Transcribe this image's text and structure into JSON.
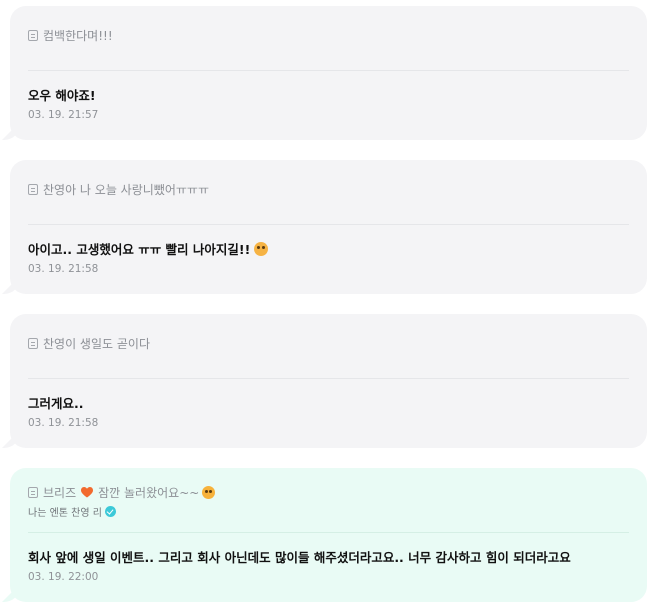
{
  "comments": [
    {
      "quote": "컴백한다며!!!",
      "reply": "오우 해야죠!",
      "time": "03. 19. 21:57"
    },
    {
      "quote": "찬영아 나 오늘 사랑니뺐어ㅠㅠㅠ",
      "reply": "아이고.. 고생했어요 ㅠㅠ 빨리 나아지길!!",
      "reply_emoji": "face-emoji",
      "time": "03. 19. 21:58"
    },
    {
      "quote": "찬영이 생일도 곧이다",
      "reply": "그러게요..",
      "time": "03. 19. 21:58"
    },
    {
      "quote_prefix": "브리즈",
      "quote_suffix": "잠깐 놀러왔어요~~",
      "quote_icons": [
        "orange-heart-icon",
        "face-emoji"
      ],
      "author": "나는 엔톤 찬영 리",
      "author_badge": "verified-icon",
      "reply": "회사 앞에 생일 이벤트.. 그리고 회사 아닌데도 많이들 해주셨더라고요.. 너무 감사하고 힘이 되더라고요",
      "time": "03. 19. 22:00"
    }
  ],
  "colors": {
    "card_bg": "#f4f4f6",
    "highlight_bg": "#e9fbf5",
    "accent_heart": "#f26a2e",
    "verified": "#3cc9d8"
  }
}
